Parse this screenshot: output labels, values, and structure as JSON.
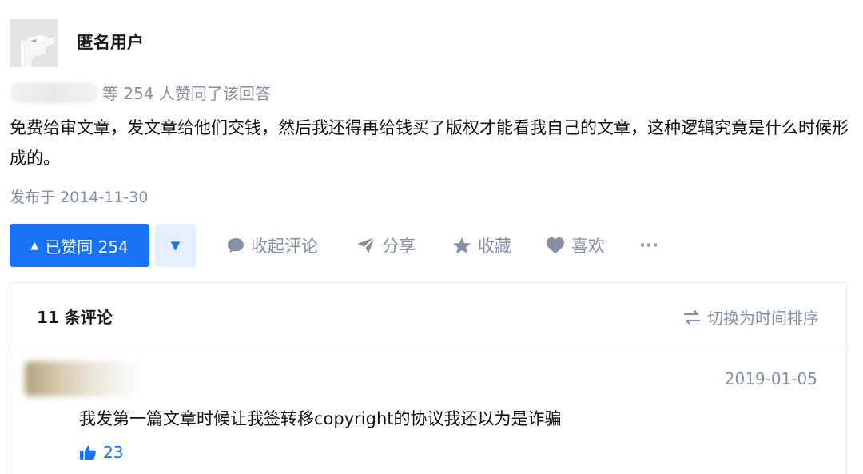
{
  "author": {
    "name": "匿名用户"
  },
  "voters": {
    "text": "等 254 人赞同了该回答"
  },
  "answer": {
    "content": "免费给审文章，发文章给他们交钱，然后我还得再给钱买了版权才能看我自己的文章，这种逻辑究竟是什么时候形成的。",
    "published": "发布于 2014-11-30"
  },
  "actions": {
    "vote_up_icon": "▲",
    "vote_up_label": "已赞同 254",
    "vote_down_icon": "▼",
    "collapse_comments": "收起评论",
    "share": "分享",
    "favorite": "收藏",
    "like": "喜欢",
    "more": "···"
  },
  "comments": {
    "count_label": "11 条评论",
    "sort_label": "切换为时间排序",
    "items": [
      {
        "date": "2019-01-05",
        "text": "我发第一篇文章时候让我签转移copyright的协议我还以为是诈骗",
        "likes": "23"
      }
    ]
  },
  "colors": {
    "brand": "#1772f6",
    "muted": "#8590a6",
    "text": "#121212"
  }
}
